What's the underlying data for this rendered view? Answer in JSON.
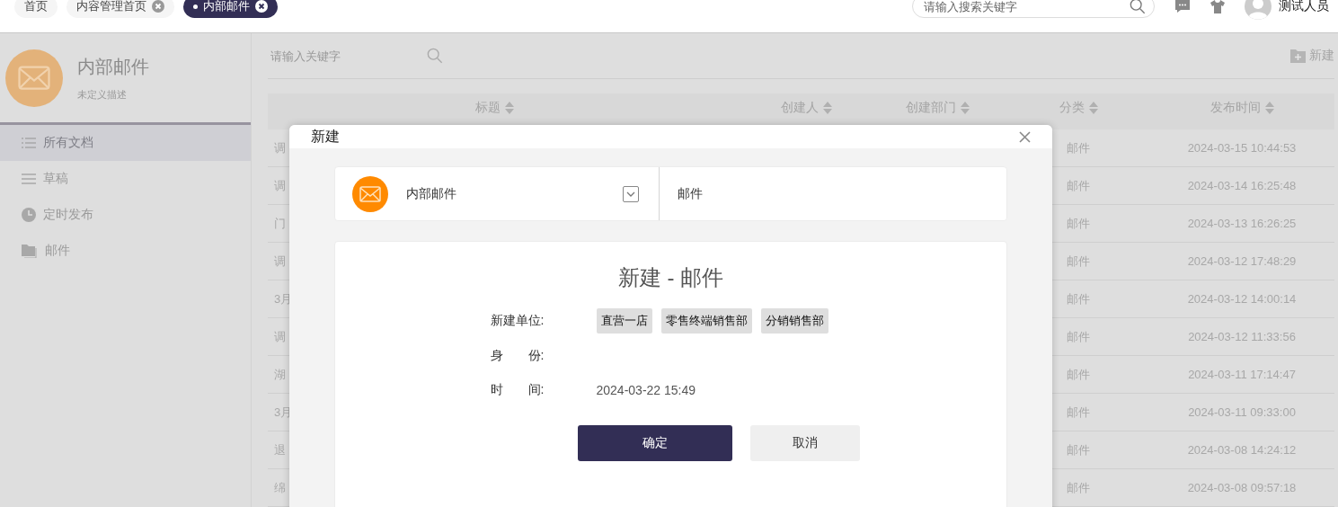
{
  "tabs": [
    {
      "label": "首页",
      "selected": false,
      "closable": false
    },
    {
      "label": "内容管理首页",
      "selected": false,
      "closable": true
    },
    {
      "label": "内部邮件",
      "selected": true,
      "closable": true
    }
  ],
  "global_search": {
    "placeholder": "请输入搜索关键字"
  },
  "user": {
    "name": "测试人员"
  },
  "sidebar": {
    "title": "内部邮件",
    "description": "未定义描述",
    "items": [
      {
        "label": "所有文档",
        "selected": true,
        "kind": "list"
      },
      {
        "label": "草稿",
        "selected": false,
        "kind": "lines"
      },
      {
        "label": "定时发布",
        "selected": false,
        "kind": "clock"
      },
      {
        "label": "邮件",
        "selected": false,
        "kind": "folder"
      }
    ]
  },
  "toolbar": {
    "search_placeholder": "请输入关键字",
    "new_button": "新建"
  },
  "table": {
    "columns": [
      "标题",
      "创建人",
      "创建部门",
      "分类",
      "发布时间"
    ],
    "rows": [
      {
        "title": "调",
        "category": "邮件",
        "time": "2024-03-15 10:44:53"
      },
      {
        "title": "调",
        "category": "邮件",
        "time": "2024-03-14 16:25:48"
      },
      {
        "title": "门",
        "category": "邮件",
        "time": "2024-03-13 16:26:25"
      },
      {
        "title": "调",
        "category": "邮件",
        "time": "2024-03-12 17:48:29"
      },
      {
        "title": "3月",
        "category": "邮件",
        "time": "2024-03-12 14:00:14"
      },
      {
        "title": "调",
        "category": "邮件",
        "time": "2024-03-12 11:33:56"
      },
      {
        "title": "湖",
        "category": "邮件",
        "time": "2024-03-11 17:14:47"
      },
      {
        "title": "3月",
        "category": "邮件",
        "time": "2024-03-11 09:33:00"
      },
      {
        "title": "退",
        "category": "邮件",
        "time": "2024-03-08 14:24:12"
      },
      {
        "title": "绵",
        "category": "邮件",
        "time": "2024-03-08 09:57:18"
      }
    ]
  },
  "dialog": {
    "title": "新建",
    "template": {
      "name": "内部邮件",
      "category": "邮件"
    },
    "heading": "新建 - 邮件",
    "fields": [
      {
        "label": "新建单位:",
        "kind": "tags",
        "tags": [
          "直营一店",
          "零售终端销售部",
          "分销销售部"
        ]
      },
      {
        "label": "身　　份:",
        "kind": "empty"
      },
      {
        "label": "时　　间:",
        "kind": "text",
        "value": "2024-03-22 15:49"
      }
    ],
    "buttons": [
      {
        "label": "确定",
        "kind": "primary"
      },
      {
        "label": "取消",
        "kind": "secondary"
      }
    ]
  }
}
